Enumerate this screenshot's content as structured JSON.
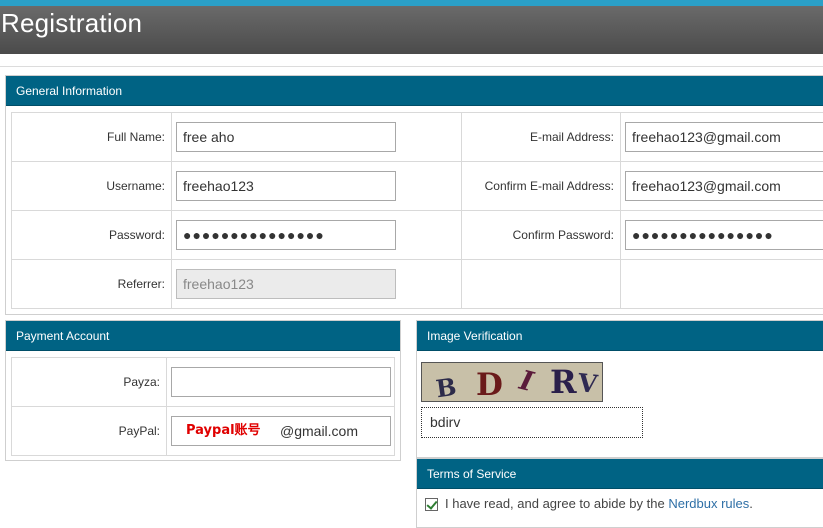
{
  "page": {
    "title": "Registration"
  },
  "general": {
    "heading": "General Information",
    "full_name_label": "Full Name:",
    "full_name_value": "free aho",
    "username_label": "Username:",
    "username_value": "freehao123",
    "password_label": "Password:",
    "password_value": "●●●●●●●●●●●●●●●",
    "referrer_label": "Referrer:",
    "referrer_value": "freehao123",
    "email_label": "E-mail Address:",
    "email_value": "freehao123@gmail.com",
    "confirm_email_label": "Confirm E-mail Address:",
    "confirm_email_value": "freehao123@gmail.com",
    "confirm_password_label": "Confirm Password:",
    "confirm_password_value": "●●●●●●●●●●●●●●●"
  },
  "payment": {
    "heading": "Payment Account",
    "payza_label": "Payza:",
    "payza_value": "",
    "paypal_label": "PayPal:",
    "paypal_overlay": "Paypal账号",
    "paypal_value_suffix": "@gmail.com"
  },
  "verification": {
    "heading": "Image Verification",
    "captcha_chars": [
      "B",
      "D",
      "I",
      "R",
      "V"
    ],
    "captcha_input_value": "bdirv"
  },
  "tos": {
    "heading": "Terms of Service",
    "text": "I have read, and agree to abide by the ",
    "link_text": "Nerdbux rules",
    "text_end": ".",
    "checked": true
  }
}
